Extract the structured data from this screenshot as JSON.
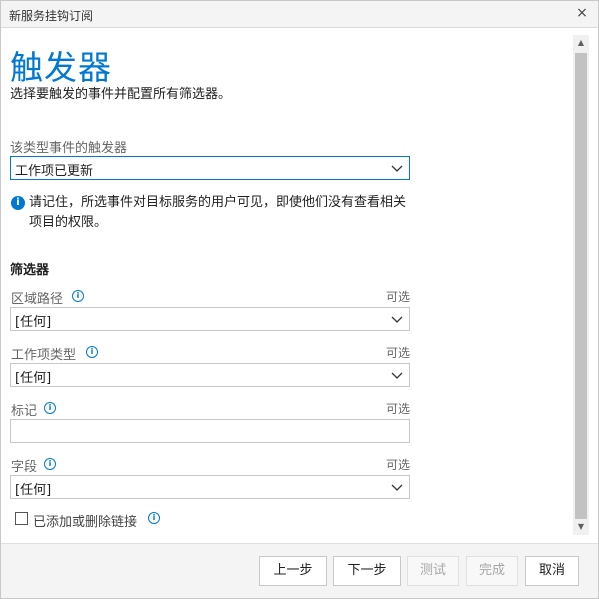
{
  "window": {
    "title": "新服务挂钩订阅",
    "close_glyph": "×"
  },
  "page": {
    "heading": "触发器",
    "subheading": "选择要触发的事件并配置所有筛选器。"
  },
  "trigger": {
    "label": "该类型事件的触发器",
    "value": "工作项已更新"
  },
  "notice": {
    "text": "请记住，所选事件对目标服务的用户可见，即使他们没有查看相关项目的权限。"
  },
  "filters": {
    "title": "筛选器",
    "optional_label": "可选",
    "area_path": {
      "label": "区域路径",
      "value": "[任何]"
    },
    "work_item_type": {
      "label": "工作项类型",
      "value": "[任何]"
    },
    "tag": {
      "label": "标记",
      "value": ""
    },
    "field": {
      "label": "字段",
      "value": "[任何]"
    },
    "links_checkbox": {
      "label": "已添加或删除链接",
      "checked": false
    }
  },
  "footer": {
    "previous": "上一步",
    "next": "下一步",
    "test": "测试",
    "finish": "完成",
    "cancel": "取消"
  },
  "colors": {
    "accent": "#0078d4",
    "footer_bg": "#f4f4f4"
  }
}
